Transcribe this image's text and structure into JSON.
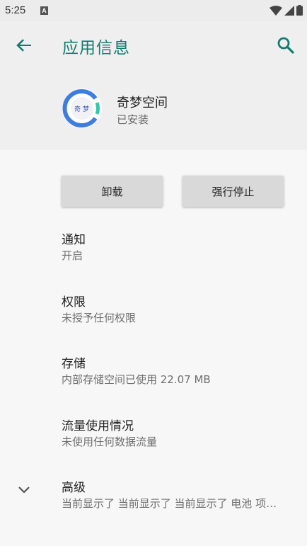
{
  "status_bar": {
    "time": "5:25",
    "a_badge": "A",
    "icons": [
      "wifi-icon",
      "signal-icon",
      "battery-icon"
    ]
  },
  "header": {
    "title": "应用信息",
    "back_icon": "arrow-left-icon",
    "search_icon": "search-icon",
    "accent_color": "#127c72"
  },
  "app": {
    "name": "奇梦空间",
    "status": "已安装",
    "icon_text": "奇 梦"
  },
  "actions": {
    "uninstall_label": "卸载",
    "force_stop_label": "强行停止"
  },
  "settings": [
    {
      "title": "通知",
      "subtitle": "开启"
    },
    {
      "title": "权限",
      "subtitle": "未授予任何权限"
    },
    {
      "title": "存储",
      "subtitle": "内部存储空间已使用 22.07 MB"
    },
    {
      "title": "流量使用情况",
      "subtitle": "未使用任何数据流量"
    },
    {
      "title": "高级",
      "subtitle": "当前显示了 当前显示了 当前显示了 电池 项…"
    }
  ]
}
